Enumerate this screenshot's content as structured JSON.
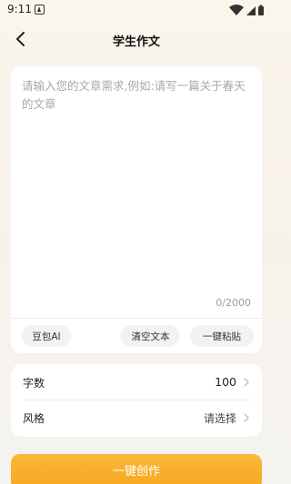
{
  "status_bar": {
    "time": "9:11"
  },
  "header": {
    "title": "学生作文"
  },
  "editor": {
    "value": "",
    "placeholder": "请输入您的文章需求,例如:请写一篇关于春天的文章",
    "char_count": "0/2000"
  },
  "actions": {
    "ai_label": "豆包AI",
    "clear_label": "清空文本",
    "paste_label": "一键粘贴"
  },
  "settings": {
    "word_count_label": "字数",
    "word_count_value": "100",
    "style_label": "风格",
    "style_value": "请选择"
  },
  "create_button": {
    "label": "一键创作"
  },
  "colors": {
    "accent": "#f8ad2a",
    "background": "#f7f2ea"
  }
}
